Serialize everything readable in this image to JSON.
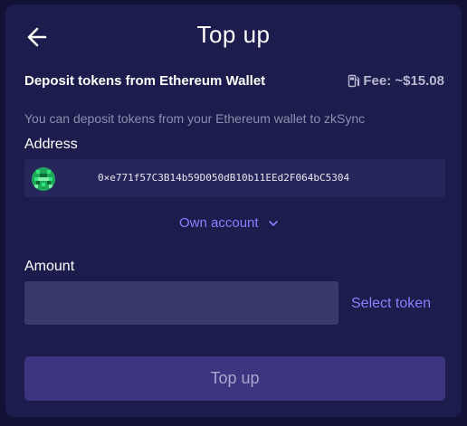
{
  "header": {
    "title": "Top up",
    "back_icon": "arrow-left-icon"
  },
  "deposit": {
    "title": "Deposit tokens from Ethereum Wallet",
    "fee_icon": "fuel-pump-icon",
    "fee_text": "Fee: ~$15.08",
    "subtitle": "You can deposit tokens from your Ethereum wallet to zkSync"
  },
  "address": {
    "label": "Address",
    "avatar_icon": "identicon-avatar",
    "value": "0×e771f57C3B14b59D050dB10b11EEd2F064bC5304",
    "own_account_label": "Own account",
    "dropdown_icon": "chevron-down-icon"
  },
  "amount": {
    "label": "Amount",
    "value": "",
    "placeholder": "",
    "select_token_label": "Select token"
  },
  "actions": {
    "top_up_label": "Top up"
  },
  "colors": {
    "background": "#121236",
    "card": "#1c1c4d",
    "accent": "#8d7fff",
    "button": "#3d3580",
    "input": "#3a3a6a"
  }
}
